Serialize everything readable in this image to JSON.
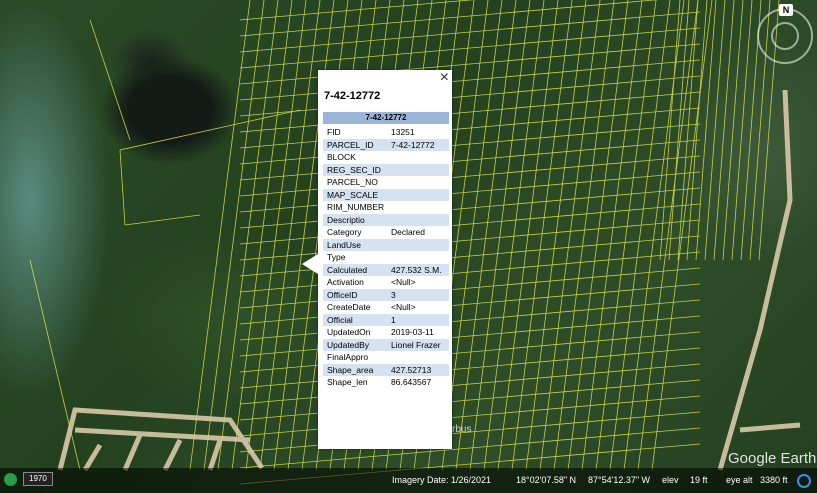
{
  "popup": {
    "title": "7-42-12772",
    "table_title": "7-42-12772",
    "close_label": "×",
    "rows": [
      {
        "key": "FID",
        "value": "13251"
      },
      {
        "key": "PARCEL_ID",
        "value": "7-42-12772"
      },
      {
        "key": "BLOCK",
        "value": ""
      },
      {
        "key": "REG_SEC_ID",
        "value": ""
      },
      {
        "key": "PARCEL_NO",
        "value": ""
      },
      {
        "key": "MAP_SCALE",
        "value": ""
      },
      {
        "key": "RIM_NUMBER",
        "value": ""
      },
      {
        "key": "Descriptio",
        "value": ""
      },
      {
        "key": "Category",
        "value": "Declared"
      },
      {
        "key": "LandUse",
        "value": ""
      },
      {
        "key": "Type",
        "value": ""
      },
      {
        "key": "Calculated",
        "value": "427.532 S.M."
      },
      {
        "key": "Activation",
        "value": "<Null>"
      },
      {
        "key": "OfficeID",
        "value": "3"
      },
      {
        "key": "CreateDate",
        "value": "<Null>"
      },
      {
        "key": "Official",
        "value": "1"
      },
      {
        "key": "UpdatedOn",
        "value": "2019-03-11"
      },
      {
        "key": "UpdatedBy",
        "value": "Lionel Frazer"
      },
      {
        "key": "FinalAppro",
        "value": ""
      },
      {
        "key": "Shape_area",
        "value": "427.52713"
      },
      {
        "key": "Shape_len",
        "value": "86.643567"
      }
    ]
  },
  "compass": {
    "north_label": "N"
  },
  "map": {
    "watermark": "Google Earth",
    "partial_label": "rbus"
  },
  "statusbar": {
    "historical_year": "1970",
    "imagery_date": "Imagery Date: 1/26/2021",
    "latitude": "18°02'07.58\" N",
    "longitude": "87°54'12.37\" W",
    "elev_label": "elev",
    "elev_value": "19 ft",
    "eye_alt_label": "eye alt",
    "eye_alt_value": "3380 ft"
  },
  "colors": {
    "parcel_lines": "#e6e64a",
    "road": "#d9c9a8",
    "table_header": "#9bb5d8",
    "row_alt": "#d4e2f2"
  }
}
